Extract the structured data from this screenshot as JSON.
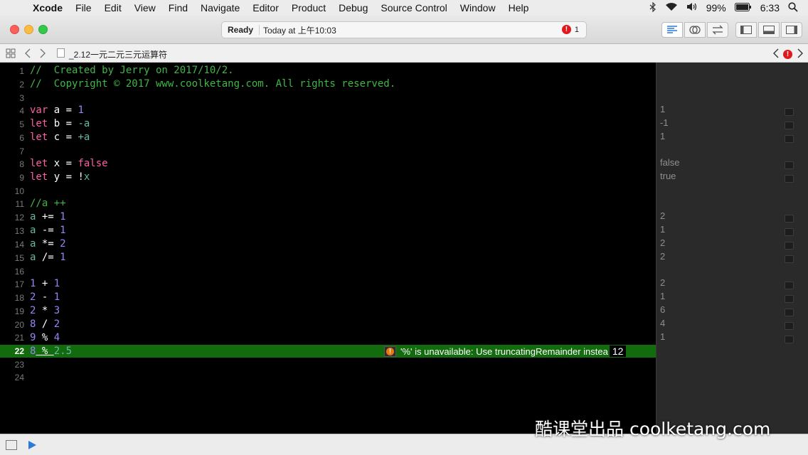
{
  "menubar": {
    "items": [
      "Xcode",
      "File",
      "Edit",
      "View",
      "Find",
      "Navigate",
      "Editor",
      "Product",
      "Debug",
      "Source Control",
      "Window",
      "Help"
    ],
    "battery": "99%",
    "clock": "6:33",
    "icons": [
      "apple-icon",
      "bluetooth-icon",
      "wifi-icon",
      "volume-icon",
      "battery-icon",
      "search-icon"
    ]
  },
  "toolbar": {
    "status": "Ready",
    "time": "Today at 上午10:03",
    "error_count": "1"
  },
  "jumpbar": {
    "filename": "_2.12一元二元三元运算符"
  },
  "editor": {
    "gutter": [
      "1",
      "2",
      "3",
      "4",
      "5",
      "6",
      "7",
      "8",
      "9",
      "10",
      "11",
      "12",
      "13",
      "14",
      "15",
      "16",
      "17",
      "18",
      "19",
      "20",
      "21",
      "22",
      "23",
      "24"
    ],
    "current_line": "22",
    "inline_error": {
      "message": "'%' is unavailable: Use truncatingRemainder instea",
      "count": "12"
    }
  },
  "code": {
    "l1a": "//  Created by Jerry on 2017/10/2.",
    "l2a": "//  Copyright © 2017 www.coolketang.com. All rights reserved.",
    "l4": [
      "var",
      " a = ",
      "1"
    ],
    "l5": [
      "let",
      " b = ",
      "-a"
    ],
    "l6": [
      "let",
      " c = ",
      "+a"
    ],
    "l8": [
      "let",
      " x = ",
      "false"
    ],
    "l9": [
      "let",
      " y = !",
      "x"
    ],
    "l11": "//a ++",
    "l12": [
      "a",
      " += ",
      "1"
    ],
    "l13": [
      "a",
      " -= ",
      "1"
    ],
    "l14": [
      "a",
      " *= ",
      "2"
    ],
    "l15": [
      "a",
      " /= ",
      "1"
    ],
    "l17": [
      "1",
      " + ",
      "1"
    ],
    "l18": [
      "2",
      " - ",
      "1"
    ],
    "l19": [
      "2",
      " * ",
      "3"
    ],
    "l20": [
      "8",
      " / ",
      "2"
    ],
    "l21": [
      "9",
      " % ",
      "4"
    ],
    "l22": [
      "8",
      " % ",
      "2.5"
    ]
  },
  "results": {
    "l4": "1",
    "l5": "-1",
    "l6": "1",
    "l8": "false",
    "l9": "true",
    "l12": "2",
    "l13": "1",
    "l14": "2",
    "l15": "2",
    "l17": "2",
    "l18": "1",
    "l19": "6",
    "l20": "4",
    "l21": "1"
  },
  "watermark": "酷课堂出品 coolketang.com",
  "colors": {
    "keyword": "#fc5fa3",
    "number": "#9686f5",
    "comment": "#41b645",
    "highlight": "#126b0d",
    "error_badge": "#e67a12"
  }
}
